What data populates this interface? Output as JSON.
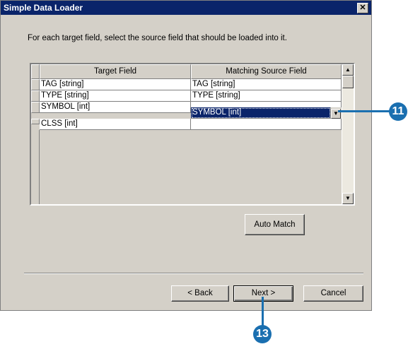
{
  "window": {
    "title": "Simple Data Loader",
    "close_glyph": "✕"
  },
  "instruction": "For each target field, select the source field that should be loaded into it.",
  "grid": {
    "columns": [
      "Target Field",
      "Matching Source Field"
    ],
    "rows": [
      {
        "target": "TAG [string]",
        "source": "TAG [string]"
      },
      {
        "target": "TYPE [string]",
        "source": "TYPE [string]"
      },
      {
        "target": "SYMBOL [int]",
        "source": "SYMBOL [int]"
      },
      {
        "target": "CLSS [int]",
        "source": ""
      }
    ],
    "selected_row": 2,
    "scroll_up_glyph": "▲",
    "scroll_down_glyph": "▼",
    "dropdown_glyph": "▼"
  },
  "buttons": {
    "auto_match": "Auto Match",
    "back": "< Back",
    "next": "Next >",
    "cancel": "Cancel"
  },
  "callouts": {
    "step_a": "11",
    "step_b": "13"
  },
  "colors": {
    "titlebar": "#0a246a",
    "callout": "#1a6fb0",
    "dialog_face": "#d4d0c8"
  }
}
